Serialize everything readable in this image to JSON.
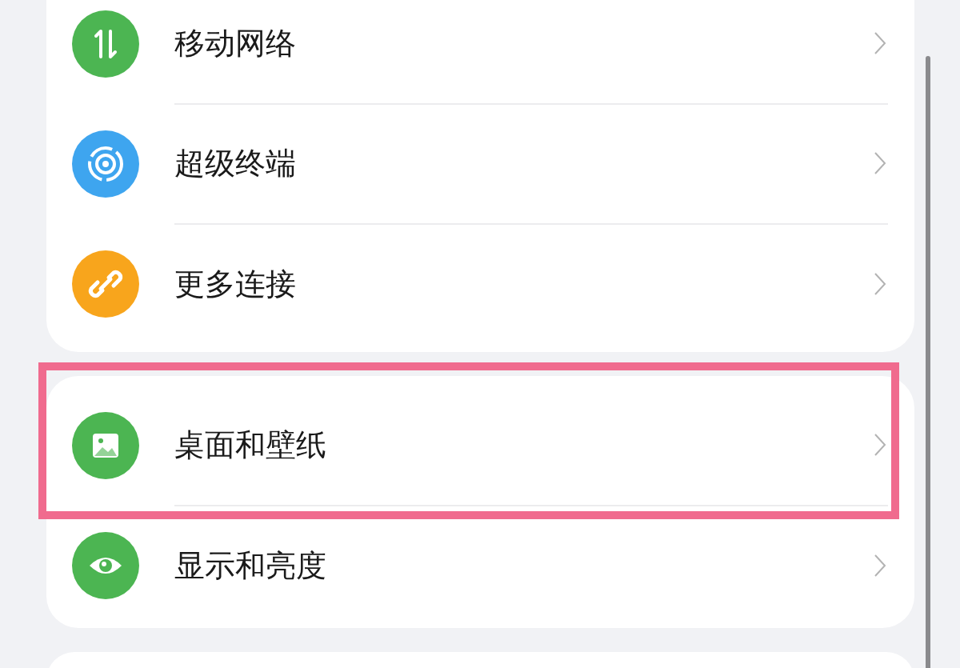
{
  "groups": [
    {
      "items": [
        {
          "label": "移动网络",
          "kind": "arrows",
          "color": "#4cb552",
          "highlighted": false
        },
        {
          "label": "超级终端",
          "kind": "target",
          "color": "#3ea5ef",
          "highlighted": false
        },
        {
          "label": "更多连接",
          "kind": "link",
          "color": "#f8a51c",
          "highlighted": false
        }
      ]
    },
    {
      "items": [
        {
          "label": "桌面和壁纸",
          "kind": "image",
          "color": "#4cb552",
          "highlighted": true
        },
        {
          "label": "显示和亮度",
          "kind": "eye",
          "color": "#4cb552",
          "highlighted": false
        }
      ]
    }
  ]
}
